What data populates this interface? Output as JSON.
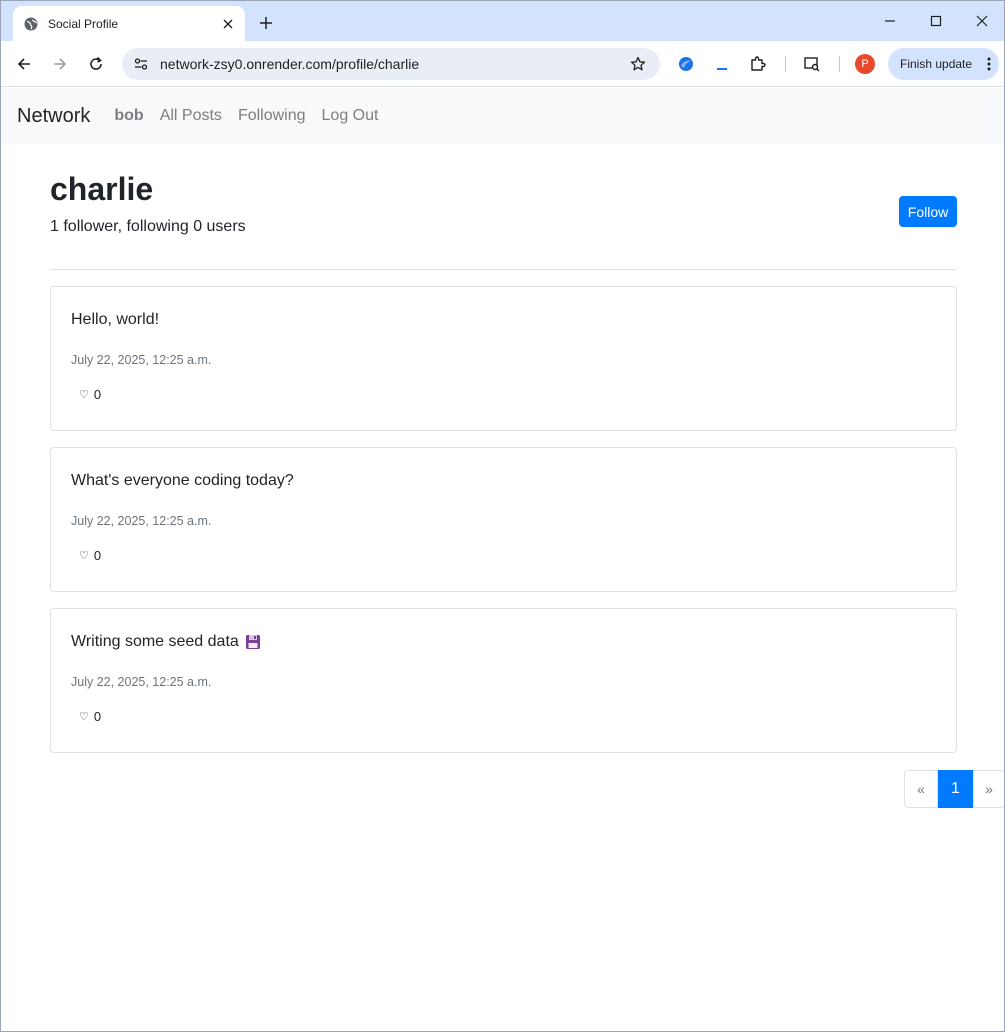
{
  "browser": {
    "tab_title": "Social Profile",
    "url": "network-zsy0.onrender.com/profile/charlie",
    "profile_initial": "P",
    "finish_update_label": "Finish update"
  },
  "navbar": {
    "brand": "Network",
    "user": "bob",
    "all_posts": "All Posts",
    "following": "Following",
    "logout": "Log Out"
  },
  "profile": {
    "username": "charlie",
    "stats": "1 follower, following 0 users",
    "follow_label": "Follow"
  },
  "posts": [
    {
      "text": "Hello, world!",
      "date": "July 22, 2025, 12:25 a.m.",
      "likes": "0",
      "heart": "♡"
    },
    {
      "text": "What's everyone coding today?",
      "date": "July 22, 2025, 12:25 a.m.",
      "likes": "0",
      "heart": "♡"
    },
    {
      "text": "Writing some seed data",
      "date": "July 22, 2025, 12:25 a.m.",
      "likes": "0",
      "heart": "♡",
      "emoji_icon": "floppy-disk-icon"
    }
  ],
  "pagination": {
    "prev": "«",
    "current": "1",
    "next": "»"
  },
  "colors": {
    "primary": "#007bff",
    "tabstrip": "#d3e3fd",
    "navbar_bg": "#f8f9fa"
  }
}
